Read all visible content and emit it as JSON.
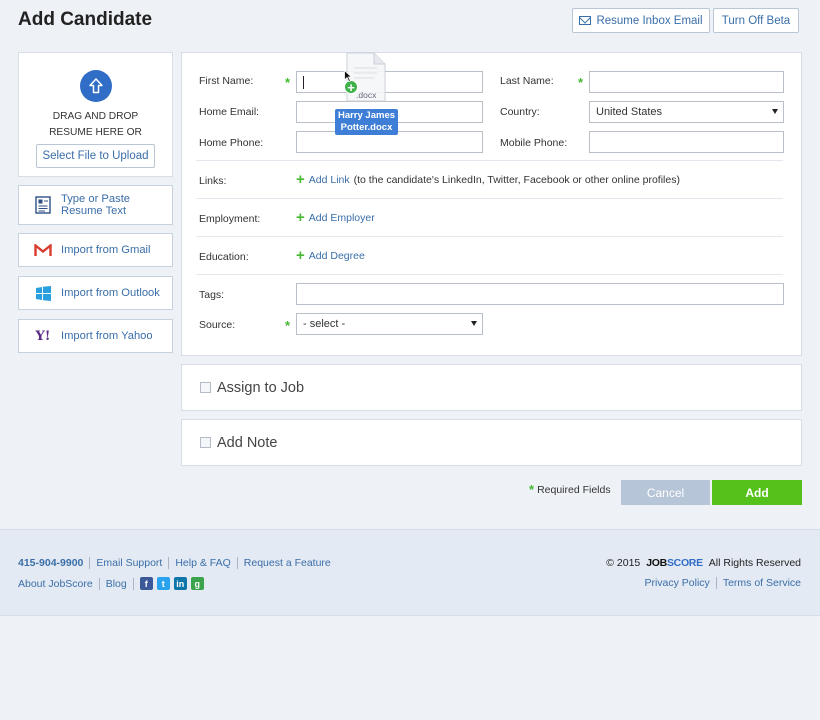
{
  "page": {
    "title": "Add Candidate"
  },
  "top_buttons": {
    "resume_inbox": "Resume Inbox Email",
    "turn_off_beta": "Turn Off Beta"
  },
  "upload": {
    "drag_line1": "DRAG AND DROP",
    "drag_line2": "RESUME HERE OR",
    "select_button": "Select File to Upload"
  },
  "import_options": [
    {
      "label_line1": "Type or Paste",
      "label_line2": "Resume Text",
      "icon": "resume-text-icon"
    },
    {
      "label": "Import from Gmail",
      "icon": "gmail-icon"
    },
    {
      "label": "Import from Outlook",
      "icon": "windows-icon"
    },
    {
      "label": "Import from Yahoo",
      "icon": "yahoo-icon"
    }
  ],
  "form": {
    "first_name_label": "First Name:",
    "first_name_value": "",
    "last_name_label": "Last Name:",
    "last_name_value": "",
    "home_email_label": "Home Email:",
    "home_email_value": "",
    "country_label": "Country:",
    "country_value": "United States",
    "home_phone_label": "Home Phone:",
    "home_phone_value": "",
    "mobile_phone_label": "Mobile Phone:",
    "mobile_phone_value": "",
    "links_label": "Links:",
    "add_link": "Add Link",
    "add_link_hint": "(to the candidate's LinkedIn, Twitter, Facebook or other online profiles)",
    "employment_label": "Employment:",
    "add_employer": "Add Employer",
    "education_label": "Education:",
    "add_degree": "Add Degree",
    "tags_label": "Tags:",
    "tags_value": "",
    "source_label": "Source:",
    "source_value": "- select -",
    "required_star": "*"
  },
  "sections": {
    "assign_job": "Assign to Job",
    "add_note": "Add Note"
  },
  "actions": {
    "required_fields": "Required Fields",
    "cancel": "Cancel",
    "add": "Add"
  },
  "drag_file": {
    "ext": ".docx",
    "name_line1": "Harry James",
    "name_line2": "Potter.docx"
  },
  "footer": {
    "phone": "415-904-9900",
    "email_support": "Email Support",
    "help": "Help & FAQ",
    "request": "Request a Feature",
    "about": "About JobScore",
    "blog": "Blog",
    "copyright": "© 2015",
    "brand_a": "JOB",
    "brand_b": "SCORE",
    "rights": "All Rights Reserved",
    "privacy": "Privacy Policy",
    "terms": "Terms of Service"
  },
  "colors": {
    "accent": "#2f6dc7",
    "link": "#3a6ea8",
    "green": "#55c21b",
    "cancel": "#b6c5d7"
  }
}
